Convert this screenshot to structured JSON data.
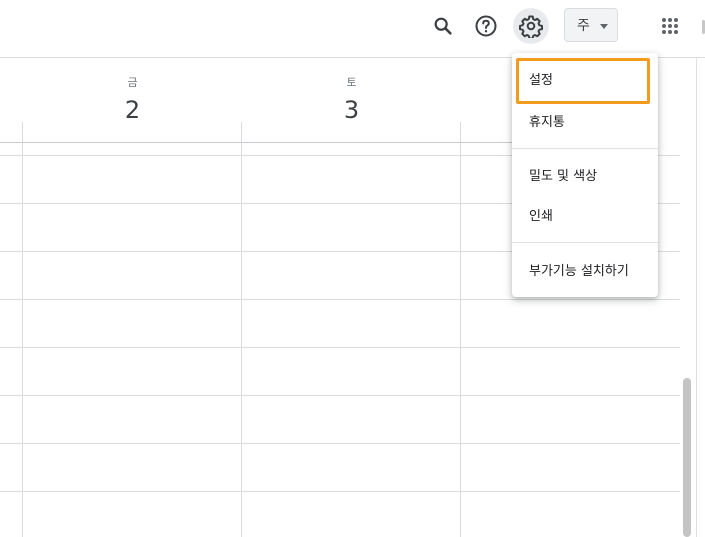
{
  "toolbar": {
    "search_icon": "search-icon",
    "help_icon": "help-icon",
    "settings_icon": "settings-icon",
    "view_label": "주",
    "apps_icon": "apps-grid-icon"
  },
  "days": [
    {
      "dow": "금",
      "num": "2"
    },
    {
      "dow": "토",
      "num": "3"
    }
  ],
  "settings_menu": {
    "items": [
      "설정",
      "휴지통",
      "밀도 및 색상",
      "인쇄",
      "부가기능 설치하기"
    ],
    "selected": "설정"
  },
  "colors": {
    "highlight": "#f29b1d",
    "grid": "#dadce0",
    "active_bg": "#e8eaed"
  }
}
